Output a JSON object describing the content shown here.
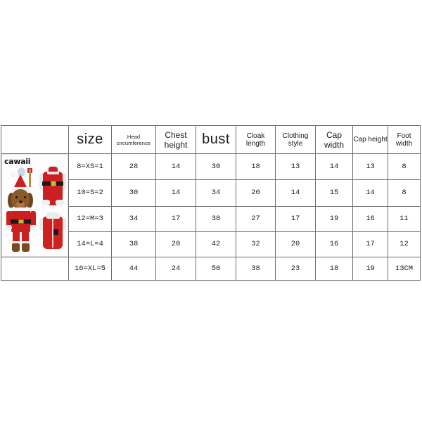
{
  "product_image": {
    "watermark": "cawaii",
    "alt": "santa-dog-costume-photo"
  },
  "table": {
    "headers": [
      "",
      "size",
      "Head circumference",
      "Chest height",
      "bust",
      "Cloak length",
      "Clothing style",
      "Cap width",
      "Cap height",
      "Foot width"
    ],
    "rows": [
      {
        "size": "8=XS=1",
        "head_circumference": "28",
        "chest_height": "14",
        "bust": "30",
        "cloak_length": "18",
        "clothing_style": "13",
        "cap_width": "14",
        "cap_height": "13",
        "foot_width": "8"
      },
      {
        "size": "10=S=2",
        "head_circumference": "30",
        "chest_height": "14",
        "bust": "34",
        "cloak_length": "20",
        "clothing_style": "14",
        "cap_width": "15",
        "cap_height": "14",
        "foot_width": "8"
      },
      {
        "size": "12=M=3",
        "head_circumference": "34",
        "chest_height": "17",
        "bust": "38",
        "cloak_length": "27",
        "clothing_style": "17",
        "cap_width": "19",
        "cap_height": "16",
        "foot_width": "11"
      },
      {
        "size": "14=L=4",
        "head_circumference": "38",
        "chest_height": "20",
        "bust": "42",
        "cloak_length": "32",
        "clothing_style": "20",
        "cap_width": "16",
        "cap_height": "17",
        "foot_width": "12"
      },
      {
        "size": "16=XL=5",
        "head_circumference": "44",
        "chest_height": "24",
        "bust": "50",
        "cloak_length": "38",
        "clothing_style": "23",
        "cap_width": "18",
        "cap_height": "19",
        "foot_width": "13CM"
      }
    ]
  },
  "colors": {
    "border": "#6e6e6e",
    "background": "#ffffff",
    "text": "#1a1a1a",
    "costume_red": "#cc1f1f",
    "costume_white": "#f0f0f0"
  }
}
